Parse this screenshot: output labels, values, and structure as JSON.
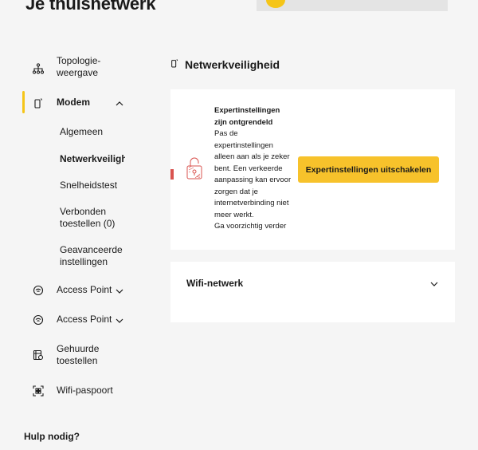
{
  "page": {
    "title": "Je thuisnetwerk"
  },
  "nav": {
    "items": [
      {
        "label": "Topologie-\nweergave",
        "icon": "topology-icon"
      },
      {
        "label": "Modem",
        "icon": "modem-icon",
        "expanded": true
      },
      {
        "label": "Access Point",
        "icon": "access-point-icon"
      },
      {
        "label": "Access Point",
        "icon": "access-point-icon"
      },
      {
        "label": "Gehuurde\ntoestellen",
        "icon": "rented-devices-icon"
      },
      {
        "label": "Wifi-paspoort",
        "icon": "qr-icon"
      }
    ],
    "modem_sub": [
      {
        "label": "Algemeen"
      },
      {
        "label": "Netwerkveiligheid",
        "active": true
      },
      {
        "label": "Snelheidstest"
      },
      {
        "label": "Verbonden\ntoestellen (0)"
      },
      {
        "label": "Geavanceerde\ninstellingen"
      }
    ]
  },
  "help": {
    "label": "Hulp nodig?"
  },
  "section": {
    "title": "Netwerkveiligheid"
  },
  "expert_card": {
    "heading": "Expertinstellingen zijn ontgrendeld",
    "lines": [
      "Pas de",
      "expertinstellingen",
      "alleen aan als je zeker",
      "bent. Een verkeerde",
      "aanpassing kan ervoor",
      "zorgen dat je",
      "internetverbinding niet",
      "meer werkt.",
      "Ga voorzichtig verder"
    ],
    "button_label": "Expertinstellingen uitschakelen"
  },
  "wifi_card": {
    "title": "Wifi-netwerk"
  },
  "colors": {
    "accent": "#f7c22b",
    "warning": "#d9534f",
    "background": "#f5f5f5"
  }
}
